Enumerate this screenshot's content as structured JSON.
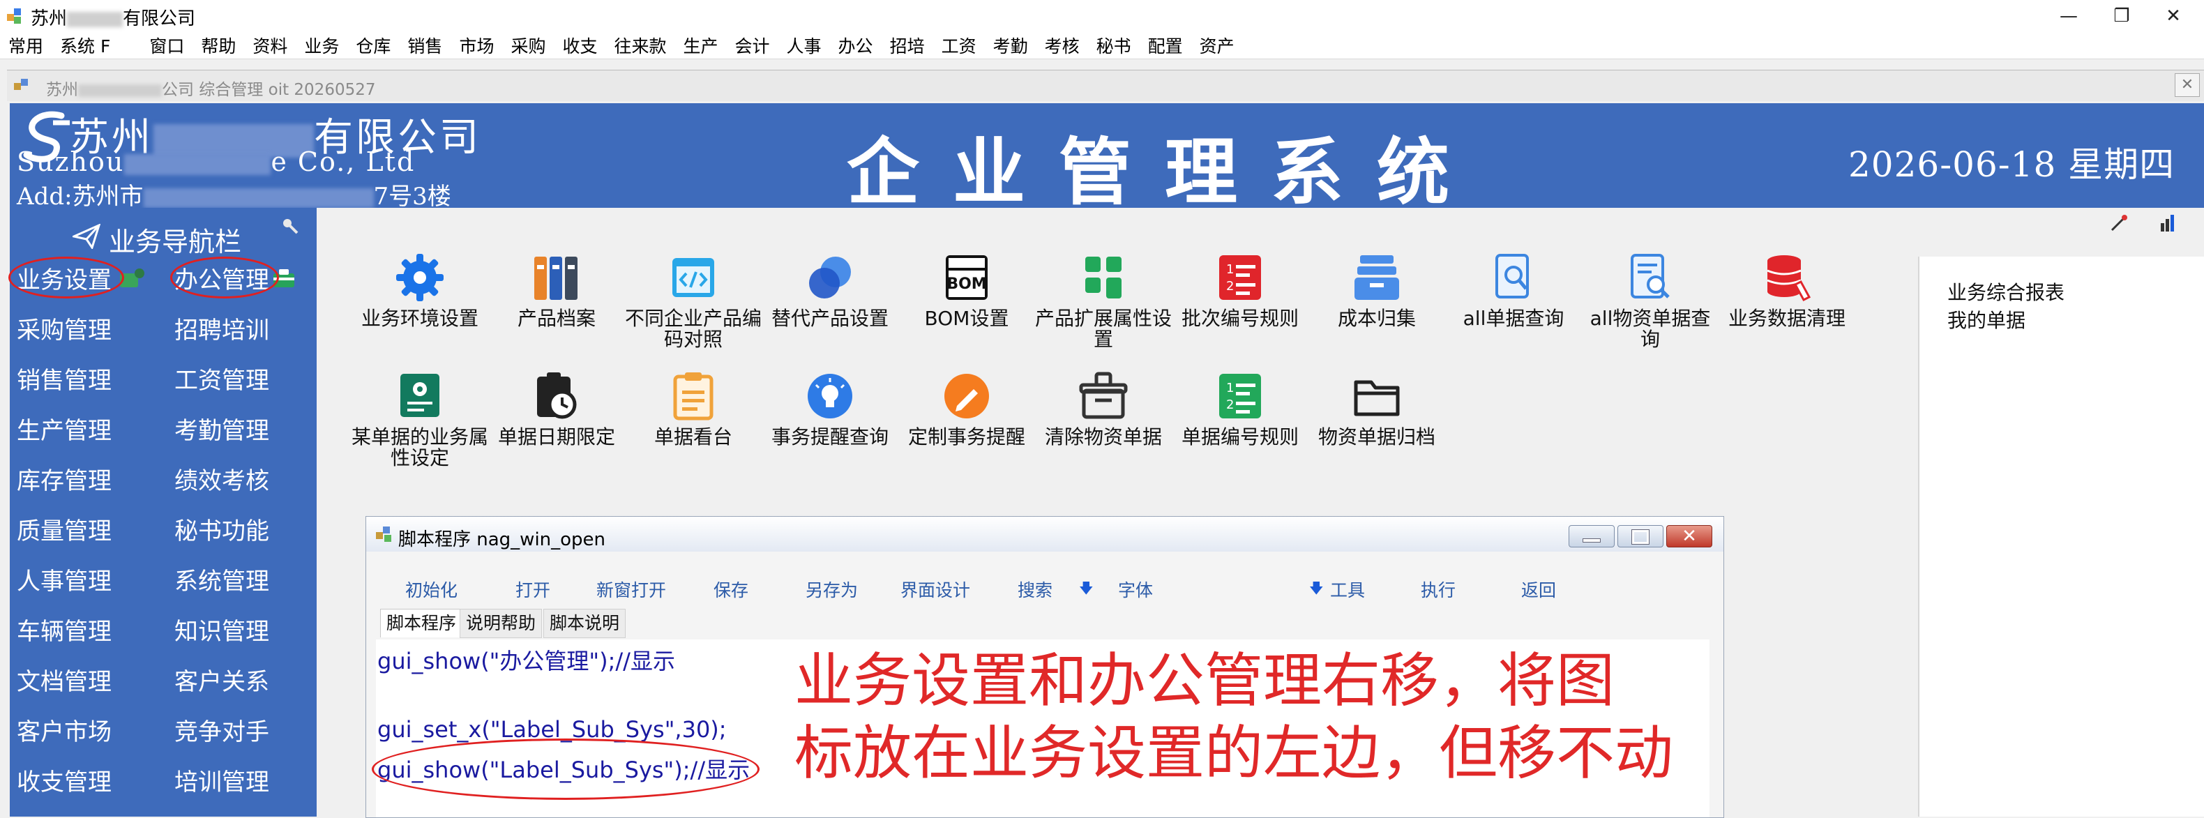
{
  "window": {
    "title_prefix": "苏州",
    "title_suffix": "有限公司"
  },
  "menubar": [
    "常用",
    "系统 F",
    "窗口",
    "帮助",
    "资料",
    "业务",
    "仓库",
    "销售",
    "市场",
    "采购",
    "收支",
    "往来款",
    "生产",
    "会计",
    "人事",
    "办公",
    "招培",
    "工资",
    "考勤",
    "考核",
    "秘书",
    "配置",
    "资产"
  ],
  "mdi": {
    "caption_prefix": "苏州",
    "caption_suffix": "公司 综合管理 oit 20260527",
    "close_glyph": "✕"
  },
  "banner": {
    "company_cn_prefix": "苏州",
    "company_cn_suffix": "有限公司",
    "company_en_prefix": "Suzhou",
    "company_en_suffix": "e Co., Ltd",
    "company_addr_prefix": "Add:苏州市",
    "company_addr_suffix": "7号3楼",
    "system_title": "企业管理系统",
    "date": "2026-06-18 星期四"
  },
  "sidebar": {
    "nav_title": "业务导航栏",
    "left_items": [
      "业务设置",
      "采购管理",
      "销售管理",
      "生产管理",
      "库存管理",
      "质量管理",
      "人事管理",
      "车辆管理",
      "文档管理",
      "客户市场",
      "收支管理"
    ],
    "right_items": [
      "办公管理",
      "招聘培训",
      "工资管理",
      "考勤管理",
      "绩效考核",
      "秘书功能",
      "系统管理",
      "知识管理",
      "客户关系",
      "竞争对手",
      "培训管理"
    ]
  },
  "tiles_row1": [
    {
      "label": "业务环境设置",
      "icon": "gear-icon"
    },
    {
      "label": "产品档案",
      "icon": "binders-icon"
    },
    {
      "label": "不同企业产品编码对照",
      "icon": "code-icon"
    },
    {
      "label": "替代产品设置",
      "icon": "overlap-circles-icon"
    },
    {
      "label": "BOM设置",
      "icon": "bom-icon"
    },
    {
      "label": "产品扩展属性设置",
      "icon": "grid-icon"
    },
    {
      "label": "批次编号规则",
      "icon": "numbered-list-icon"
    },
    {
      "label": "成本归集",
      "icon": "archive-icon"
    },
    {
      "label": "all单据查询",
      "icon": "doc-search-icon"
    },
    {
      "label": "all物资单据查询",
      "icon": "doc-magnifier-icon"
    },
    {
      "label": "业务数据清理",
      "icon": "database-clean-icon"
    }
  ],
  "tiles_row2": [
    {
      "label": "某单据的业务属性设定",
      "icon": "doc-gear-icon"
    },
    {
      "label": "单据日期限定",
      "icon": "clipboard-clock-icon"
    },
    {
      "label": "单据看台",
      "icon": "clipboard-icon"
    },
    {
      "label": "事务提醒查询",
      "icon": "bulb-icon"
    },
    {
      "label": "定制事务提醒",
      "icon": "pencil-icon"
    },
    {
      "label": "清除物资单据",
      "icon": "clear-box-icon"
    },
    {
      "label": "单据编号规则",
      "icon": "numbered-list-green-icon"
    },
    {
      "label": "物资单据归档",
      "icon": "folder-icon"
    }
  ],
  "right_panel": [
    "业务综合报表",
    "我的单据"
  ],
  "script_window": {
    "title": "脚本程序  nag_win_open",
    "toolbar": [
      "初始化",
      "打开",
      "新窗打开",
      "保存",
      "另存为",
      "界面设计",
      "搜索",
      "字体",
      "工具",
      "执行",
      "返回"
    ],
    "tabs": [
      "脚本程序",
      "说明帮助",
      "脚本说明"
    ],
    "code_lines": [
      "gui_show(\"办公管理\");//显示",
      "gui_set_x(\"Label_Sub_Sys\",30);",
      "gui_show(\"Label_Sub_Sys\");//显示"
    ],
    "annotation_lines": [
      "业务设置和办公管理右移，将图",
      "标放在业务设置的左边，但移不动"
    ]
  }
}
